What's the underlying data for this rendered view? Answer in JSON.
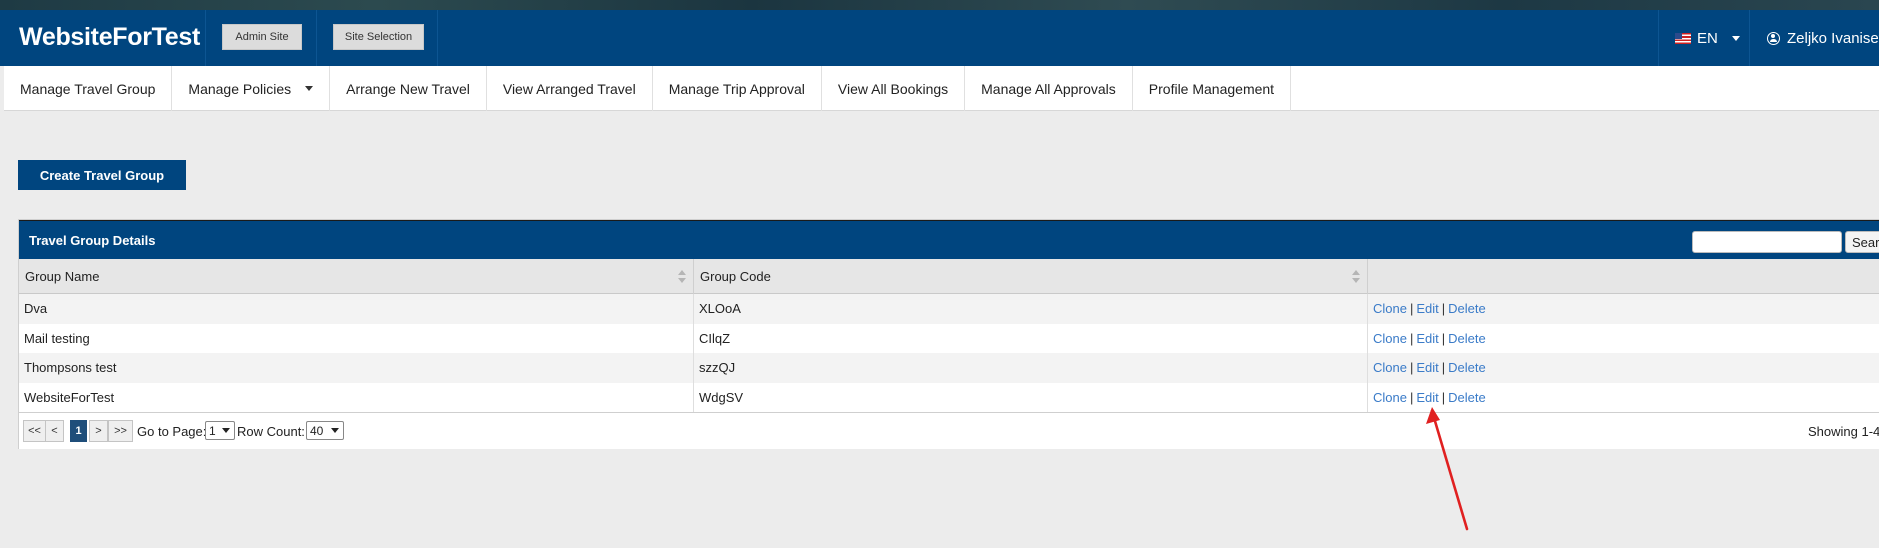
{
  "header": {
    "brand": "WebsiteForTest",
    "admin_site_label": "Admin Site",
    "site_selection_label": "Site Selection",
    "language": "EN",
    "user_name": "Zeljko Ivanisevi"
  },
  "nav": {
    "items": [
      {
        "label": "Manage Travel Group"
      },
      {
        "label": "Manage Policies"
      },
      {
        "label": "Arrange New Travel"
      },
      {
        "label": "View Arranged Travel"
      },
      {
        "label": "Manage Trip Approval"
      },
      {
        "label": "View All Bookings"
      },
      {
        "label": "Manage All Approvals"
      },
      {
        "label": "Profile Management"
      }
    ]
  },
  "create_button": "Create Travel Group",
  "panel": {
    "title": "Travel Group Details",
    "search_value": "",
    "search_button": "Searc",
    "columns": [
      "Group Name",
      "Group Code"
    ],
    "rows": [
      {
        "name": "Dva",
        "code": "XLOoA"
      },
      {
        "name": "Mail testing",
        "code": "CIlqZ"
      },
      {
        "name": "Thompsons test",
        "code": "szzQJ"
      },
      {
        "name": "WebsiteForTest",
        "code": "WdgSV"
      }
    ],
    "actions": {
      "clone": "Clone",
      "edit": "Edit",
      "delete": "Delete",
      "separator": "|"
    }
  },
  "pager": {
    "first": "<<",
    "prev": "<",
    "current_page": "1",
    "next": ">",
    "last": ">>",
    "goto_label": "Go to Page:",
    "goto_value": "1",
    "rowcount_label": "Row Count:",
    "rowcount_value": "40",
    "showing": "Showing 1-4"
  },
  "colors": {
    "brand_blue": "#00457f",
    "link_blue": "#3a7bc8",
    "annotation_arrow": "#e02020"
  }
}
